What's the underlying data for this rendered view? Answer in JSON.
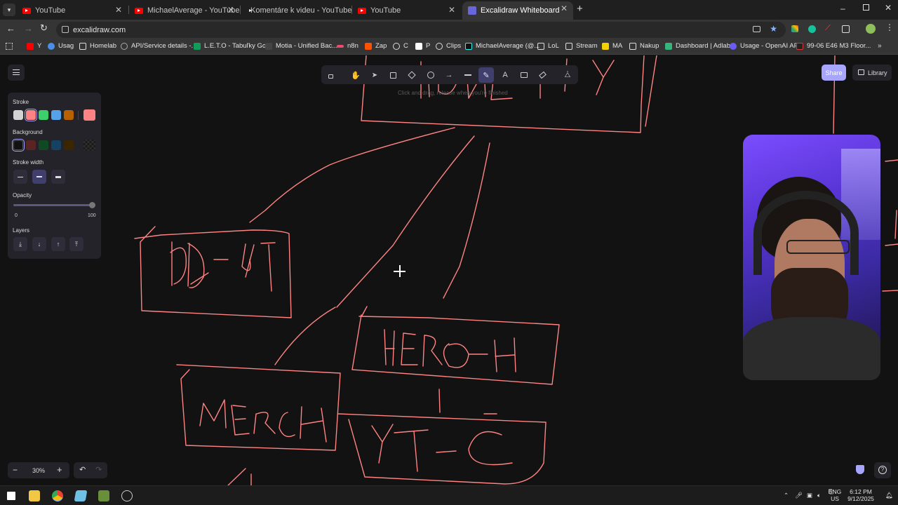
{
  "browser": {
    "tabs": [
      {
        "title": "YouTube"
      },
      {
        "title": "MichaelAverage - YouTube"
      },
      {
        "title": "Komentáre k videu - YouTube S"
      },
      {
        "title": "YouTube"
      },
      {
        "title": "Excalidraw Whiteboard"
      }
    ],
    "url": "excalidraw.com",
    "bookmarks": [
      "Y",
      "Usag",
      "Homelab",
      "API/Service details -...",
      "L.E.T.O - Tabuľky Go...",
      "Motia - Unified Bac...",
      "n8n",
      "Zap",
      "C",
      "P",
      "Clips",
      "MichaelAverage (@...",
      "LoL",
      "Stream",
      "MA",
      "Nakup",
      "Dashboard | Adlab",
      "Usage - OpenAI API",
      "99-06 E46 M3 Floor..."
    ]
  },
  "excalidraw": {
    "hint": "Click and drag, release when you're finished",
    "share_label": "Share",
    "library_label": "Library",
    "props": {
      "stroke_label": "Stroke",
      "background_label": "Background",
      "stroke_width_label": "Stroke width",
      "opacity_label": "Opacity",
      "opacity_min": "0",
      "opacity_max": "100",
      "opacity_value": 100,
      "layers_label": "Layers",
      "stroke_colors": [
        "#d3d3d3",
        "#ff8383",
        "#3ccf6b",
        "#56a2e8",
        "#b76100"
      ],
      "stroke_selected": "#ff8383",
      "background_colors": [
        "#121212",
        "#5c2323",
        "#0f4a25",
        "#154163",
        "#3b2600"
      ]
    },
    "zoom_level": "30%",
    "canvas_texts": [
      "AD-YT",
      "HERO-H",
      "MERCH",
      "YT-C",
      "MONEY"
    ]
  },
  "taskbar": {
    "lang": "ENG",
    "region": "US",
    "time": "6:12 PM",
    "date": "9/12/2025"
  }
}
